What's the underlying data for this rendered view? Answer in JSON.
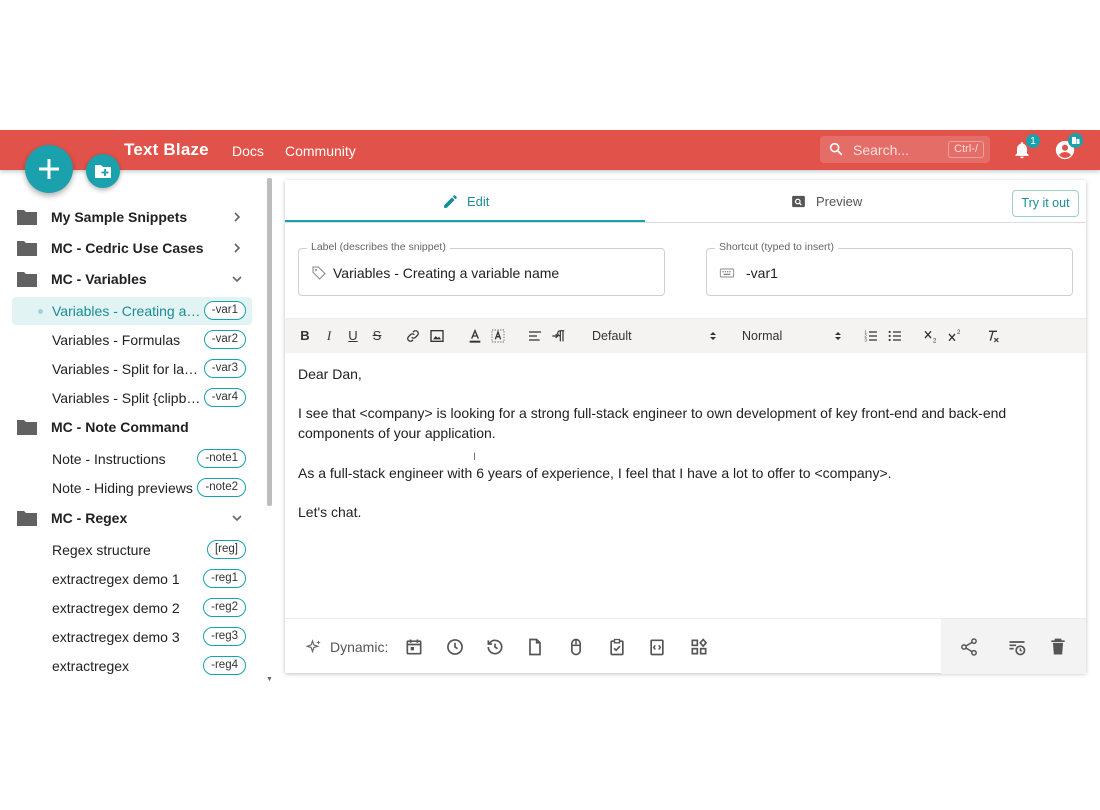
{
  "header": {
    "brand": "Text Blaze",
    "nav": [
      "Docs",
      "Community"
    ],
    "search_placeholder": "Search...",
    "search_shortcut": "Ctrl-/",
    "notification_count": "1",
    "accent": "#e1524a"
  },
  "sidebar": {
    "folders": [
      {
        "label": "My Sample Snippets",
        "expanded": false
      },
      {
        "label": "MC - Cedric Use Cases",
        "expanded": false
      },
      {
        "label": "MC - Variables",
        "expanded": true
      },
      {
        "label": "MC - Note Command",
        "expanded": false
      },
      {
        "label": "MC - Regex",
        "expanded": true
      }
    ],
    "snippets": [
      {
        "label": "Variables - Creating a variable name",
        "shortcut": "-var1",
        "active": true
      },
      {
        "label": "Variables - Formulas",
        "shortcut": "-var2"
      },
      {
        "label": "Variables - Split for last name",
        "shortcut": "-var3"
      },
      {
        "label": "Variables - Split {clipboard}",
        "shortcut": "-var4"
      },
      {
        "label": "Note - Instructions",
        "shortcut": "-note1"
      },
      {
        "label": "Note - Hiding previews",
        "shortcut": "-note2"
      },
      {
        "label": "Regex structure",
        "shortcut": "[reg]"
      },
      {
        "label": "extractregex demo 1",
        "shortcut": "-reg1"
      },
      {
        "label": "extractregex demo 2",
        "shortcut": "-reg2"
      },
      {
        "label": "extractregex demo 3",
        "shortcut": "-reg3"
      },
      {
        "label": "extractregex",
        "shortcut": "-reg4"
      }
    ]
  },
  "editor": {
    "tabs": {
      "edit": "Edit",
      "preview": "Preview"
    },
    "try_button": "Try it out",
    "label_field": {
      "label": "Label (describes the snippet)",
      "value": "Variables - Creating a variable name"
    },
    "shortcut_field": {
      "label": "Shortcut (typed to insert)",
      "value": "-var1"
    },
    "toolbar": {
      "bold": "B",
      "italic": "I",
      "underline": "U",
      "strike": "S",
      "font": "Default",
      "size": "Normal"
    },
    "content": {
      "greeting": "Dear Dan,",
      "p1": "I see that <company> is looking for a strong full-stack engineer to own development of key front-end and back-end components of your application.",
      "p2": "As a full-stack engineer with 6 years of experience, I feel that I have a lot to offer to <company>.",
      "p3": "Let's chat."
    },
    "dynamic_label": "Dynamic:"
  },
  "colors": {
    "brand_red": "#e1524a",
    "teal": "#1aa1ad"
  }
}
